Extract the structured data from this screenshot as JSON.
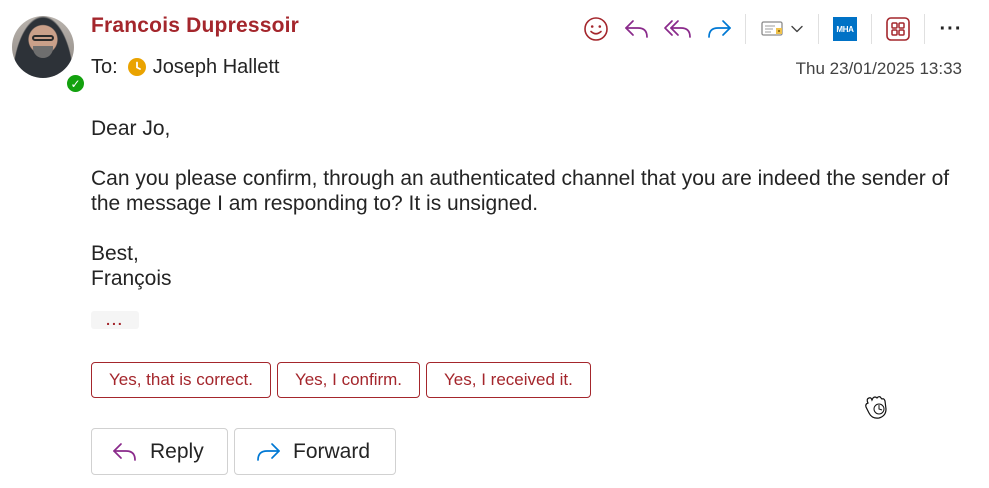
{
  "message": {
    "sender_name": "Francois Dupressoir",
    "to_label": "To:",
    "recipient": "Joseph Hallett",
    "date": "Thu 23/01/2025 13:33",
    "greeting": "Dear Jo,",
    "body_line": "Can you please confirm, through an authenticated channel that you are indeed the sender of the message I am responding to? It is unsigned.",
    "signoff": "Best,",
    "signature": "François",
    "expand_dots": "..."
  },
  "toolbar": {
    "icons": [
      "emoji-icon",
      "reply-icon",
      "reply-all-icon",
      "forward-icon",
      "sensitivity-icon",
      "mha-icon",
      "apps-icon",
      "more-icon"
    ],
    "mha_label": "MHA",
    "more_label": "···"
  },
  "suggested_replies": [
    "Yes, that is correct.",
    "Yes, I confirm.",
    "Yes, I received it."
  ],
  "actions": {
    "reply_label": "Reply",
    "forward_label": "Forward"
  },
  "colors": {
    "accent": "#a4262c",
    "presence": "#13a10e",
    "mha": "#0072c6",
    "reply_icon": "#8a2a8b",
    "forward_icon": "#0078d4",
    "clock": "#eaa300"
  }
}
